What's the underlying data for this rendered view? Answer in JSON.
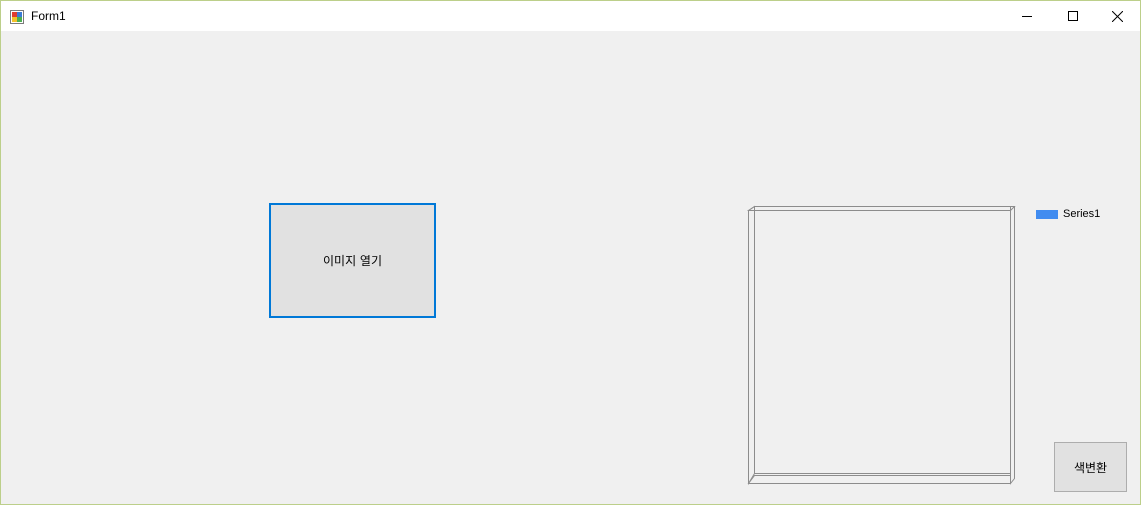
{
  "window": {
    "title": "Form1",
    "icon": "winforms-app-icon",
    "controls": [
      "minimize-icon",
      "maximize-icon",
      "close-icon"
    ]
  },
  "buttons": {
    "open_image": "이미지 열기",
    "color_convert": "색변환"
  },
  "chart_data": {
    "type": "bar",
    "categories": [],
    "series": [
      {
        "name": "Series1",
        "values": [],
        "color": "#418cf0"
      }
    ],
    "title": "",
    "xlabel": "",
    "ylabel": "",
    "legend_position": "top-right",
    "style": "3d-empty-plot-area"
  }
}
